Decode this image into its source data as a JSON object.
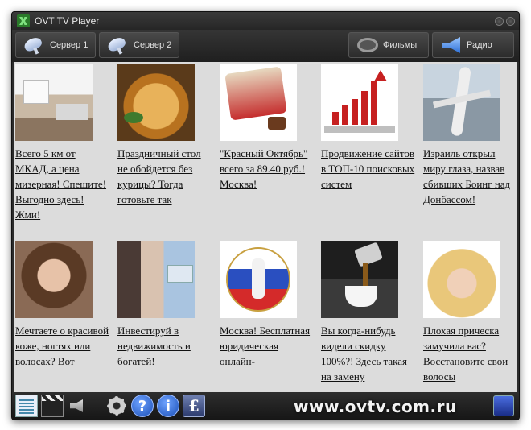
{
  "window": {
    "title": "OVT TV Player"
  },
  "toolbar": {
    "server1_label": "Сервер 1",
    "server2_label": "Сервер 2",
    "movies_label": "Фильмы",
    "radio_label": "Радио"
  },
  "ads": [
    {
      "text": "Всего 5 км от МКАД, а цена мизерная! Спешите! Выгодно здесь! Жми!"
    },
    {
      "text": "Праздничный стол не обойдется без курицы? Тогда готовьте так"
    },
    {
      "text": "\"Красный Октябрь\" всего за 89.40 руб.! Москва!"
    },
    {
      "text": "Продвижение сайтов в ТОП-10 поисковых систем"
    },
    {
      "text": "Израиль открыл миру глаза, назвав сбивших Боинг над Донбассом!"
    },
    {
      "text": "Мечтаете о красивой коже, ногтях или волосах? Вот"
    },
    {
      "text": "Инвестируй в недвижимость и богатей!"
    },
    {
      "text": "Москва! Бесплатная юридическая онлайн-"
    },
    {
      "text": "Вы когда-нибудь видели скидку 100%?! Здесь такая на замену"
    },
    {
      "text": "Плохая прическа замучила вас? Восстановите свои волосы"
    }
  ],
  "bottom": {
    "site_text": "www.ovtv.com.ru"
  },
  "colors": {
    "window_bg": "#2b2b2b",
    "content_bg": "#dcdcdc",
    "accent_blue": "#2d6fd6"
  }
}
